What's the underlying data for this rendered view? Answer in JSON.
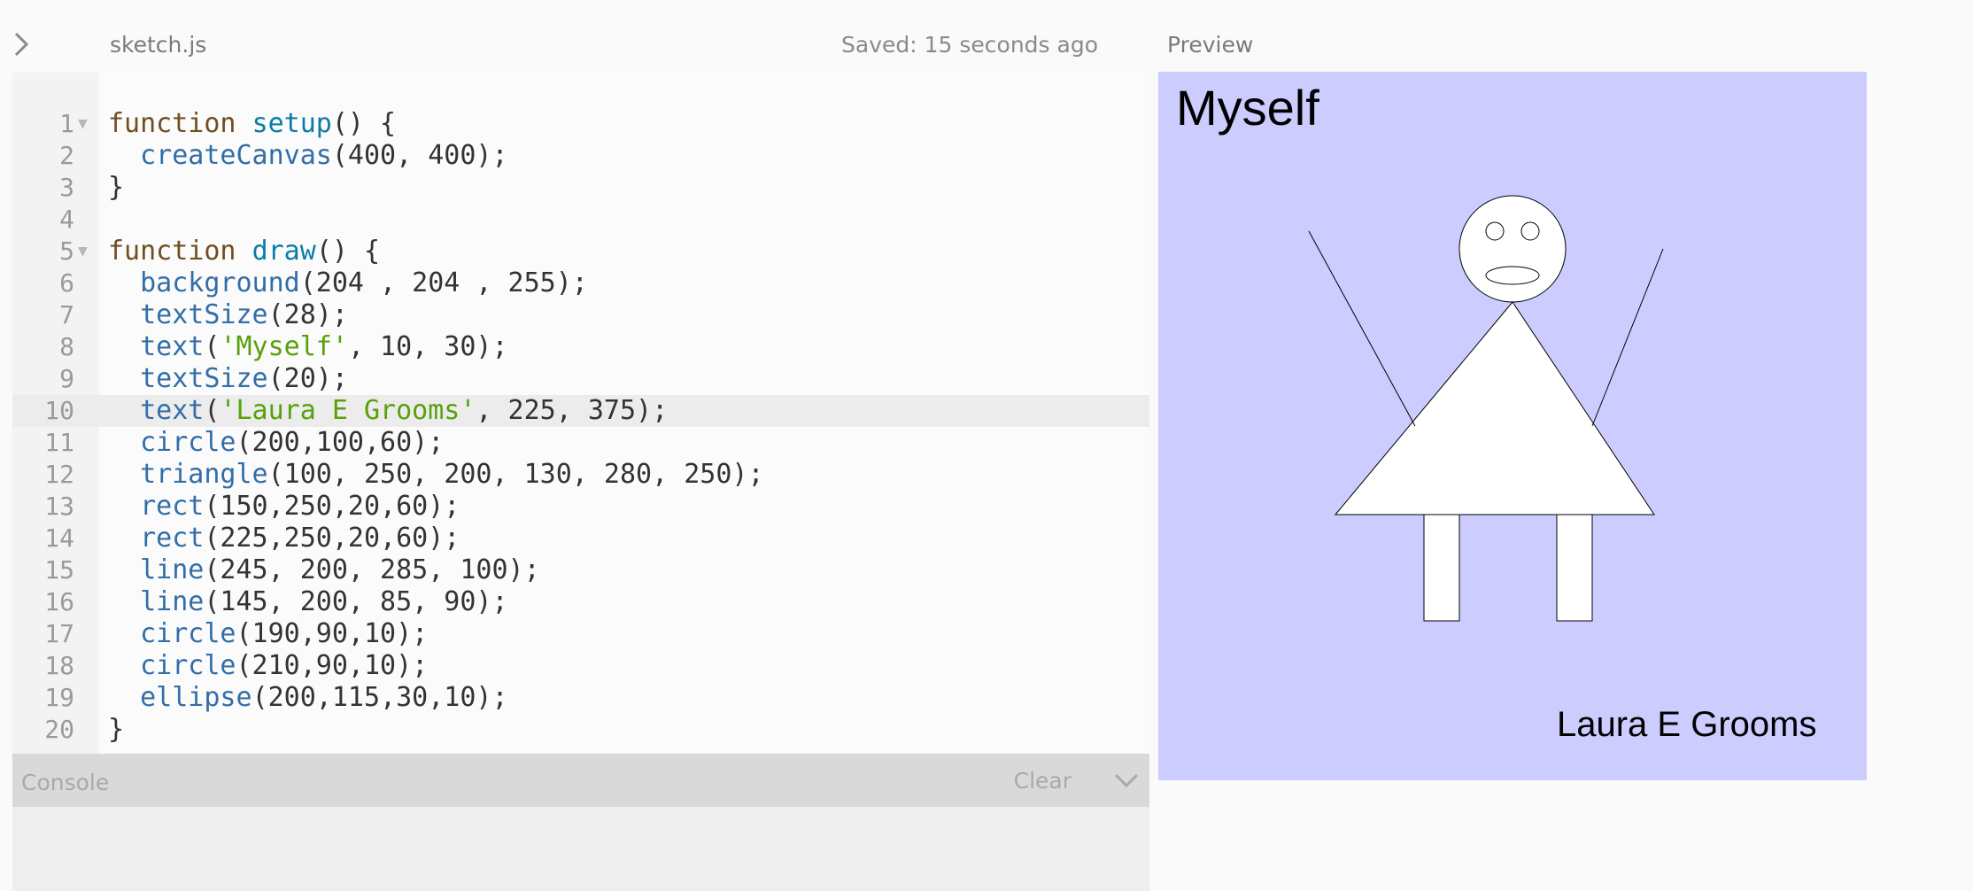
{
  "header": {
    "file_name": "sketch.js",
    "saved_status": "Saved: 15 seconds ago",
    "preview_label": "Preview"
  },
  "editor": {
    "active_line": 10,
    "lines": [
      {
        "n": "1",
        "fold": "▼",
        "tokens": [
          {
            "t": "function ",
            "c": "kw"
          },
          {
            "t": "setup",
            "c": "fn"
          },
          {
            "t": "() {",
            "c": ""
          }
        ]
      },
      {
        "n": "2",
        "fold": "",
        "tokens": [
          {
            "t": "  ",
            "c": ""
          },
          {
            "t": "createCanvas",
            "c": "bi"
          },
          {
            "t": "(400, 400);",
            "c": ""
          }
        ]
      },
      {
        "n": "3",
        "fold": "",
        "tokens": [
          {
            "t": "}",
            "c": ""
          }
        ]
      },
      {
        "n": "4",
        "fold": "",
        "tokens": []
      },
      {
        "n": "5",
        "fold": "▼",
        "tokens": [
          {
            "t": "function ",
            "c": "kw"
          },
          {
            "t": "draw",
            "c": "fn"
          },
          {
            "t": "() {",
            "c": ""
          }
        ]
      },
      {
        "n": "6",
        "fold": "",
        "tokens": [
          {
            "t": "  ",
            "c": ""
          },
          {
            "t": "background",
            "c": "bi"
          },
          {
            "t": "(204 , 204 , 255);",
            "c": ""
          }
        ]
      },
      {
        "n": "7",
        "fold": "",
        "tokens": [
          {
            "t": "  ",
            "c": ""
          },
          {
            "t": "textSize",
            "c": "bi"
          },
          {
            "t": "(28);",
            "c": ""
          }
        ]
      },
      {
        "n": "8",
        "fold": "",
        "tokens": [
          {
            "t": "  ",
            "c": ""
          },
          {
            "t": "text",
            "c": "bi"
          },
          {
            "t": "(",
            "c": ""
          },
          {
            "t": "'Myself'",
            "c": "str"
          },
          {
            "t": ", 10, 30);",
            "c": ""
          }
        ]
      },
      {
        "n": "9",
        "fold": "",
        "tokens": [
          {
            "t": "  ",
            "c": ""
          },
          {
            "t": "textSize",
            "c": "bi"
          },
          {
            "t": "(20);",
            "c": ""
          }
        ]
      },
      {
        "n": "10",
        "fold": "",
        "tokens": [
          {
            "t": "  ",
            "c": ""
          },
          {
            "t": "text",
            "c": "bi"
          },
          {
            "t": "(",
            "c": ""
          },
          {
            "t": "'Laura E Grooms'",
            "c": "str"
          },
          {
            "t": ", 225, 375);",
            "c": ""
          }
        ]
      },
      {
        "n": "11",
        "fold": "",
        "tokens": [
          {
            "t": "  ",
            "c": ""
          },
          {
            "t": "circle",
            "c": "bi"
          },
          {
            "t": "(200,100,60);",
            "c": ""
          }
        ]
      },
      {
        "n": "12",
        "fold": "",
        "tokens": [
          {
            "t": "  ",
            "c": ""
          },
          {
            "t": "triangle",
            "c": "bi"
          },
          {
            "t": "(100, 250, 200, 130, 280, 250);",
            "c": ""
          }
        ]
      },
      {
        "n": "13",
        "fold": "",
        "tokens": [
          {
            "t": "  ",
            "c": ""
          },
          {
            "t": "rect",
            "c": "bi"
          },
          {
            "t": "(150,250,20,60);",
            "c": ""
          }
        ]
      },
      {
        "n": "14",
        "fold": "",
        "tokens": [
          {
            "t": "  ",
            "c": ""
          },
          {
            "t": "rect",
            "c": "bi"
          },
          {
            "t": "(225,250,20,60);",
            "c": ""
          }
        ]
      },
      {
        "n": "15",
        "fold": "",
        "tokens": [
          {
            "t": "  ",
            "c": ""
          },
          {
            "t": "line",
            "c": "bi"
          },
          {
            "t": "(245, 200, 285, 100);",
            "c": ""
          }
        ]
      },
      {
        "n": "16",
        "fold": "",
        "tokens": [
          {
            "t": "  ",
            "c": ""
          },
          {
            "t": "line",
            "c": "bi"
          },
          {
            "t": "(145, 200, 85, 90);",
            "c": ""
          }
        ]
      },
      {
        "n": "17",
        "fold": "",
        "tokens": [
          {
            "t": "  ",
            "c": ""
          },
          {
            "t": "circle",
            "c": "bi"
          },
          {
            "t": "(190,90,10);",
            "c": ""
          }
        ]
      },
      {
        "n": "18",
        "fold": "",
        "tokens": [
          {
            "t": "  ",
            "c": ""
          },
          {
            "t": "circle",
            "c": "bi"
          },
          {
            "t": "(210,90,10);",
            "c": ""
          }
        ]
      },
      {
        "n": "19",
        "fold": "",
        "tokens": [
          {
            "t": "  ",
            "c": ""
          },
          {
            "t": "ellipse",
            "c": "bi"
          },
          {
            "t": "(200,115,30,10);",
            "c": ""
          }
        ]
      },
      {
        "n": "20",
        "fold": "",
        "tokens": [
          {
            "t": "}",
            "c": ""
          }
        ]
      }
    ]
  },
  "console": {
    "label": "Console",
    "clear_label": "Clear"
  },
  "preview": {
    "background": "#ccccff",
    "title_text": "Myself",
    "name_text": "Laura E Grooms"
  },
  "icons": {
    "expand": "chevron-right-icon",
    "collapse_console": "chevron-down-icon"
  }
}
